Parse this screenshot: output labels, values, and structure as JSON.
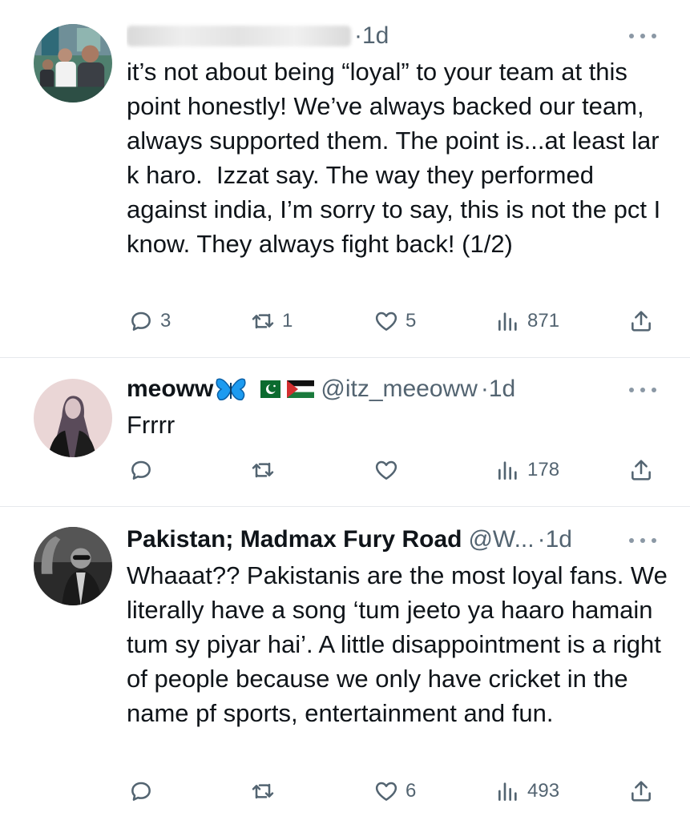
{
  "tweets": [
    {
      "display_name": "",
      "handle": "",
      "separator": "·",
      "time": "1d",
      "text": "it’s not about being “loyal” to your team at this point honestly! We’ve always backed our team, always supported them. The point is...at least lar k haro.  Izzat say. The way they performed against india, I’m sorry to say, this is not the pct I know. They always fight back! (1/2)",
      "replies": "3",
      "reposts": "1",
      "likes": "5",
      "views": "871"
    },
    {
      "display_name": "meoww",
      "handle": "@itz_meeoww",
      "separator": "·",
      "time": "1d",
      "text": "Frrrr",
      "replies": "",
      "reposts": "",
      "likes": "",
      "views": "178"
    },
    {
      "display_name": "Pakistan; Madmax Fury Road",
      "handle": "@W...",
      "separator": "·",
      "time": "1d",
      "text": "Whaaat?? Pakistanis are the most loyal fans. We literally have a song ‘tum jeeto ya haaro hamain tum sy piyar hai’. A little disappointment is a right of people because we only have cricket in the name pf sports, entertainment and fun.",
      "replies": "",
      "reposts": "",
      "likes": "6",
      "views": "493"
    }
  ],
  "icons": {
    "reply": "reply-icon",
    "repost": "repost-icon",
    "like": "heart-icon",
    "views": "analytics-icon",
    "share": "share-icon",
    "more": "more-options-icon"
  },
  "colors": {
    "text": "#0f1419",
    "secondary": "#536471",
    "divider": "#e6e9ec",
    "butterfly": "#1d9bf0"
  }
}
